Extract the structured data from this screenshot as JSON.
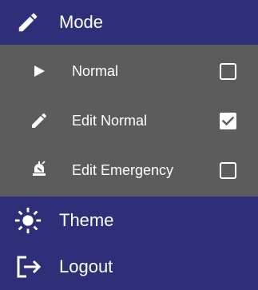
{
  "menu": {
    "mode": {
      "label": "Mode",
      "icon": "pencil-icon"
    },
    "submenu": {
      "items": [
        {
          "label": "Normal",
          "icon": "play-icon",
          "checked": false
        },
        {
          "label": "Edit Normal",
          "icon": "pencil-icon",
          "checked": true
        },
        {
          "label": "Edit Emergency",
          "icon": "alarm-bell-icon",
          "checked": false
        }
      ]
    },
    "theme": {
      "label": "Theme",
      "icon": "sun-icon"
    },
    "logout": {
      "label": "Logout",
      "icon": "logout-icon"
    }
  },
  "colors": {
    "menu_background": "#2e2f78",
    "submenu_background": "#5c5c5c",
    "text": "#ffffff"
  }
}
